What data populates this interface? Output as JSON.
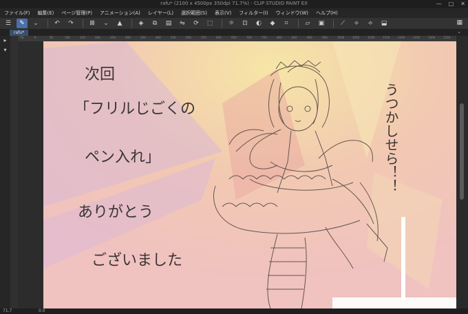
{
  "window": {
    "title": "rafu* (2100 x 4500px 350dpi 71.7%) - CLIP STUDIO PAINT EX",
    "controls": [
      "—",
      "□",
      "✕"
    ]
  },
  "menu": {
    "items": [
      "ファイル(F)",
      "編集(E)",
      "ページ管理(P)",
      "アニメーション(A)",
      "レイヤー(L)",
      "選択範囲(S)",
      "表示(V)",
      "フィルター(I)",
      "ウィンドウ(W)",
      "ヘルプ(H)"
    ]
  },
  "toolbar": {
    "icons": [
      "menu-icon",
      "pen-icon",
      "undo-icon",
      "redo-icon",
      "clear-icon",
      "fill-icon",
      "transform-icon",
      "flip-icon",
      "select-icon",
      "lasso-icon",
      "brush-settings-icon",
      "layer-icon",
      "color-icon",
      "ruler-icon"
    ]
  },
  "tab": {
    "label": "rafu*"
  },
  "status": {
    "zoom": "71.7",
    "angle": "0.0"
  },
  "ruler": {
    "ticks": [
      "-50",
      "0",
      "50",
      "100",
      "150",
      "200",
      "250",
      "300",
      "350",
      "400",
      "450",
      "500",
      "550",
      "600",
      "650",
      "700",
      "750",
      "800",
      "850",
      "900",
      "950",
      "1000",
      "1050",
      "1100",
      "1150",
      "1200",
      "1250",
      "1300",
      "1350"
    ]
  },
  "artwork": {
    "text_col_1": "次回",
    "text_col_2": "「フリルじごくの",
    "text_col_3": "ペン入れ」",
    "text_col_4": "ありがとう",
    "text_col_5": "ございました",
    "text_right": "うつかしせら！！"
  }
}
